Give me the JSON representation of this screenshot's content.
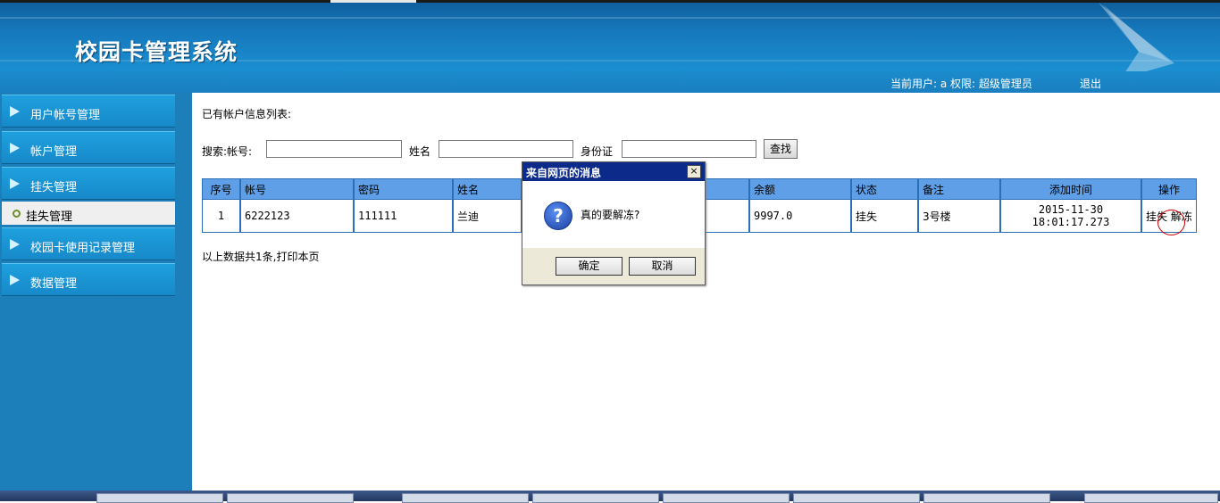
{
  "header": {
    "app_title": "校园卡管理系统",
    "user_info": "当前用户: a  权限: 超级管理员",
    "logout": "退出"
  },
  "sidebar": {
    "items": [
      {
        "label": "用户帐号管理"
      },
      {
        "label": "帐户管理"
      },
      {
        "label": "挂失管理"
      },
      {
        "label": "校园卡使用记录管理"
      },
      {
        "label": "数据管理"
      }
    ],
    "sub_item": "挂失管理"
  },
  "main": {
    "list_title": "已有帐户信息列表:",
    "search": {
      "prefix": "搜索:帐号:",
      "account_value": "",
      "name_label": "姓名",
      "name_value": "",
      "id_label": "身份证",
      "id_value": "",
      "button": "查找"
    },
    "table": {
      "headers": [
        "序号",
        "帐号",
        "密码",
        "姓名",
        "",
        "余额",
        "状态",
        "备注",
        "添加时间",
        "操作"
      ],
      "rows": [
        {
          "index": "1",
          "account": "6222123",
          "password": "111111",
          "name": "兰迪",
          "hidden": "",
          "balance": "9997.0",
          "status": "挂失",
          "remark": "3号楼",
          "time_date": "2015-11-30",
          "time_clock": "18:01:17.273",
          "op_view": "挂失",
          "op_action": "解冻"
        }
      ]
    },
    "summary_prefix": "以上数据共1条,",
    "print_link": "打印本页"
  },
  "dialog": {
    "title": "来自网页的消息",
    "close": "×",
    "icon": "question-icon",
    "message": "真的要解冻?",
    "ok": "确定",
    "cancel": "取消"
  }
}
